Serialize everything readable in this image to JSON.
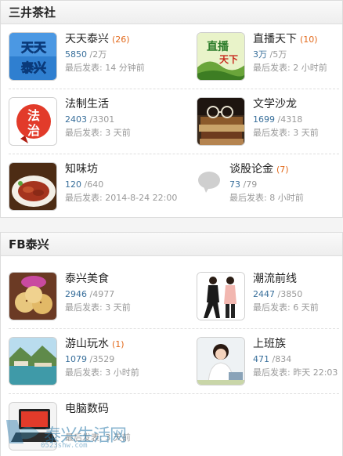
{
  "sections": [
    {
      "title": "三井茶社",
      "forums": [
        {
          "name": "天天泰兴",
          "new": "(26)",
          "threads": "5850",
          "posts": "/2万",
          "last": "最后发表: 14 分钟前",
          "icon": "tiantian-taixing-logo"
        },
        {
          "name": "直播天下",
          "new": "(10)",
          "threads": "3万",
          "posts": "/5万",
          "last": "最后发表: 2 小时前",
          "icon": "zhibo-tianxia-logo"
        },
        {
          "name": "法制生活",
          "new": "",
          "threads": "2403",
          "posts": "/3301",
          "last": "最后发表: 3 天前",
          "icon": "fazhi-logo"
        },
        {
          "name": "文学沙龙",
          "new": "",
          "threads": "1699",
          "posts": "/4318",
          "last": "最后发表: 3 天前",
          "icon": "books-glasses-image"
        },
        {
          "name": "知味坊",
          "new": "",
          "threads": "120",
          "posts": "/640",
          "last": "最后发表: 2014-8-24 22:00",
          "icon": "food-plate-image"
        },
        {
          "name": "谈股论金",
          "new": "(7)",
          "threads": "73",
          "posts": "/79",
          "last": "最后发表: 8 小时前",
          "icon": "chat-bubble-icon"
        }
      ]
    },
    {
      "title": "FB泰兴",
      "forums": [
        {
          "name": "泰兴美食",
          "new": "",
          "threads": "2946",
          "posts": "/4977",
          "last": "最后发表: 3 天前",
          "icon": "pastry-image"
        },
        {
          "name": "潮流前线",
          "new": "",
          "threads": "2447",
          "posts": "/3850",
          "last": "最后发表: 6 天前",
          "icon": "fashion-image"
        },
        {
          "name": "游山玩水",
          "new": "(1)",
          "threads": "1079",
          "posts": "/3529",
          "last": "最后发表: 3 小时前",
          "icon": "landscape-image"
        },
        {
          "name": "上班族",
          "new": "",
          "threads": "471",
          "posts": "/834",
          "last": "最后发表: 昨天 22:03",
          "icon": "office-worker-image"
        },
        {
          "name": "电脑数码",
          "new": "",
          "threads": "",
          "posts": "",
          "last": "最后发表: 3 天前",
          "icon": "computer-image"
        }
      ]
    }
  ],
  "watermark": {
    "text": "泰兴生活网",
    "url": "0523shw.com"
  },
  "colors": {
    "new_count": "#e2691b",
    "thread_count": "#376e9a",
    "meta": "#999999"
  }
}
